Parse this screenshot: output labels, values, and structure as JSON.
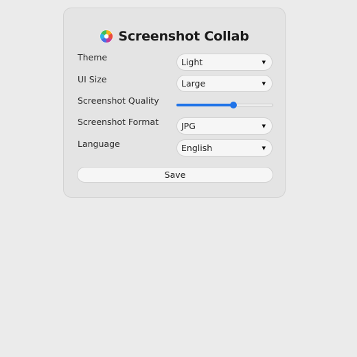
{
  "header": {
    "title": "Screenshot Collab",
    "logo_icon": "camera-aperture-icon"
  },
  "settings": {
    "theme": {
      "label": "Theme",
      "value": "Light"
    },
    "ui_size": {
      "label": "UI Size",
      "value": "Large"
    },
    "quality": {
      "label": "Screenshot Quality",
      "level": 0.59,
      "color": "#1f73e8"
    },
    "format": {
      "label": "Screenshot Format",
      "value": "JPG"
    },
    "language": {
      "label": "Language",
      "value": "English"
    }
  },
  "actions": {
    "save_label": "Save"
  },
  "icons": {
    "dropdown": "▾"
  }
}
